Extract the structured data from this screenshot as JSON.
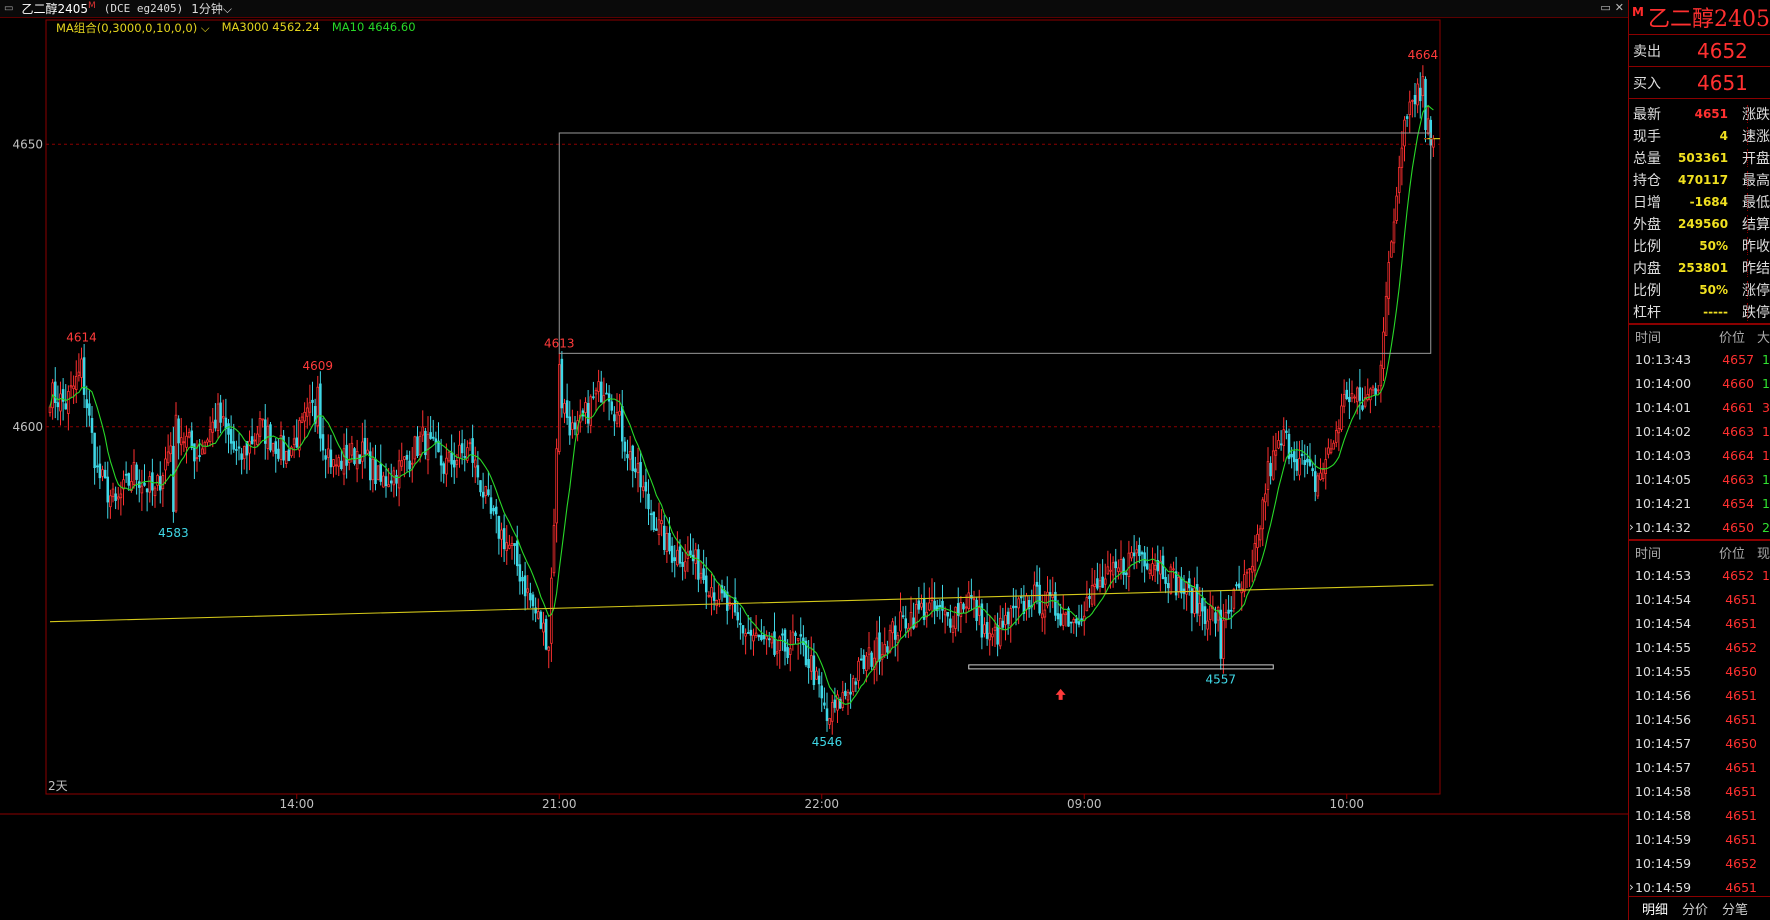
{
  "window": {
    "symbol": "乙二醇2405",
    "symbol_mark": "M",
    "code": "(DCE eg2405)",
    "period": "1分钟",
    "period_arrow": "⌵"
  },
  "legend": {
    "name": "MA组合(0,3000,0,10,0,0)",
    "ma3000": "MA3000 4562.24",
    "ma10": "MA10 4646.60"
  },
  "chart_data": {
    "type": "candlestick",
    "ylim": [
      4535,
      4672
    ],
    "y_ticks": [
      {
        "value": 4650,
        "label": "4650"
      },
      {
        "value": 4600,
        "label": "4600"
      }
    ],
    "x_ticks": [
      {
        "label": "14:00",
        "bar": 94
      },
      {
        "label": "21:00",
        "bar": 194
      },
      {
        "label": "22:00",
        "bar": 294
      },
      {
        "label": "09:00",
        "bar": 394
      },
      {
        "label": "10:00",
        "bar": 494
      }
    ],
    "day_marker": "2天",
    "current_price": 4651,
    "ma3000": {
      "start": 4565.5,
      "end": 4572.0
    },
    "anchors": [
      [
        0,
        4606
      ],
      [
        6,
        4604
      ],
      [
        12,
        4610
      ],
      [
        18,
        4592
      ],
      [
        25,
        4586
      ],
      [
        32,
        4592
      ],
      [
        40,
        4588
      ],
      [
        48,
        4600
      ],
      [
        56,
        4595
      ],
      [
        64,
        4602
      ],
      [
        72,
        4594
      ],
      [
        80,
        4600
      ],
      [
        90,
        4595
      ],
      [
        100,
        4603
      ],
      [
        108,
        4593
      ],
      [
        118,
        4596
      ],
      [
        126,
        4590
      ],
      [
        134,
        4593
      ],
      [
        142,
        4598
      ],
      [
        150,
        4593
      ],
      [
        160,
        4596
      ],
      [
        168,
        4584
      ],
      [
        176,
        4578
      ],
      [
        184,
        4568
      ],
      [
        190,
        4562
      ],
      [
        194,
        4606
      ],
      [
        200,
        4598
      ],
      [
        206,
        4604
      ],
      [
        212,
        4608
      ],
      [
        220,
        4596
      ],
      [
        228,
        4586
      ],
      [
        236,
        4578
      ],
      [
        244,
        4577
      ],
      [
        252,
        4572
      ],
      [
        262,
        4565
      ],
      [
        270,
        4562
      ],
      [
        276,
        4560
      ],
      [
        284,
        4562
      ],
      [
        290,
        4558
      ],
      [
        296,
        4548
      ],
      [
        302,
        4552
      ],
      [
        310,
        4558
      ],
      [
        318,
        4562
      ],
      [
        326,
        4566
      ],
      [
        334,
        4568
      ],
      [
        342,
        4566
      ],
      [
        350,
        4570
      ],
      [
        358,
        4562
      ],
      [
        366,
        4566
      ],
      [
        374,
        4570
      ],
      [
        382,
        4568
      ],
      [
        390,
        4566
      ],
      [
        398,
        4571
      ],
      [
        406,
        4574
      ],
      [
        414,
        4578
      ],
      [
        422,
        4576
      ],
      [
        430,
        4572
      ],
      [
        438,
        4568
      ],
      [
        446,
        4566
      ],
      [
        452,
        4570
      ],
      [
        458,
        4574
      ],
      [
        464,
        4592
      ],
      [
        470,
        4598
      ],
      [
        476,
        4594
      ],
      [
        482,
        4590
      ],
      [
        488,
        4596
      ],
      [
        494,
        4606
      ],
      [
        500,
        4604
      ],
      [
        506,
        4608
      ],
      [
        511,
        4632
      ],
      [
        516,
        4656
      ],
      [
        521,
        4660
      ],
      [
        526,
        4651
      ]
    ],
    "peaks": [
      {
        "label": "4614",
        "bar": 12,
        "value": 4614,
        "kind": "high"
      },
      {
        "label": "4583",
        "bar": 47,
        "value": 4583,
        "kind": "low"
      },
      {
        "label": "4609",
        "bar": 102,
        "value": 4609,
        "kind": "high"
      },
      {
        "label": "4613",
        "bar": 194,
        "value": 4613,
        "kind": "high"
      },
      {
        "label": "4546",
        "bar": 296,
        "value": 4546,
        "kind": "low"
      },
      {
        "label": "4557",
        "bar": 446,
        "value": 4557,
        "kind": "low"
      },
      {
        "label": "4664",
        "bar": 523,
        "value": 4664,
        "kind": "high"
      }
    ],
    "rect": {
      "from_bar": 194,
      "to_bar": 526,
      "top": 4652,
      "bottom": 4613
    },
    "support": {
      "from_bar": 350,
      "to_bar": 466,
      "value": 4557.5
    },
    "arrow_bar": 385
  },
  "quotes": {
    "sell_label": "卖出",
    "sell_value": "4652",
    "buy_label": "买入",
    "buy_value": "4651"
  },
  "stats": [
    {
      "label": "最新",
      "value": "4651",
      "color": "red",
      "right": "涨跌"
    },
    {
      "label": "现手",
      "value": "4",
      "color": "yel",
      "right": "速涨"
    },
    {
      "label": "总量",
      "value": "503361",
      "color": "yel",
      "right": "开盘"
    },
    {
      "label": "持仓",
      "value": "470117",
      "color": "yel",
      "right": "最高"
    },
    {
      "label": "日增",
      "value": "-1684",
      "color": "yel",
      "right": "最低"
    },
    {
      "label": "外盘",
      "value": "249560",
      "color": "yel",
      "right": "结算"
    },
    {
      "label": "比例",
      "value": "50%",
      "color": "yel",
      "right": "昨收"
    },
    {
      "label": "内盘",
      "value": "253801",
      "color": "yel",
      "right": "昨结"
    },
    {
      "label": "比例",
      "value": "50%",
      "color": "yel",
      "right": "涨停"
    },
    {
      "label": "杠杆",
      "value": "-----",
      "color": "yel",
      "right": "跌停"
    }
  ],
  "ticks1": {
    "head": [
      "时间",
      "价位",
      "大"
    ],
    "rows": [
      {
        "time": "10:13:43",
        "price": "4657",
        "vol": "1",
        "pc": "red",
        "vc": "grn"
      },
      {
        "time": "10:14:00",
        "price": "4660",
        "vol": "1",
        "pc": "red",
        "vc": "grn"
      },
      {
        "time": "10:14:01",
        "price": "4661",
        "vol": "3",
        "pc": "red",
        "vc": "red"
      },
      {
        "time": "10:14:02",
        "price": "4663",
        "vol": "1",
        "pc": "red",
        "vc": "red"
      },
      {
        "time": "10:14:03",
        "price": "4664",
        "vol": "1",
        "pc": "red",
        "vc": "red"
      },
      {
        "time": "10:14:05",
        "price": "4663",
        "vol": "1",
        "pc": "red",
        "vc": "grn"
      },
      {
        "time": "10:14:21",
        "price": "4654",
        "vol": "1",
        "pc": "red",
        "vc": "grn"
      },
      {
        "time": "10:14:32",
        "price": "4650",
        "vol": "2",
        "pc": "red",
        "vc": "grn"
      }
    ]
  },
  "ticks2": {
    "head": [
      "时间",
      "价位",
      "现"
    ],
    "rows": [
      {
        "time": "10:14:53",
        "price": "4652",
        "vol": "1",
        "pc": "red",
        "vc": "red"
      },
      {
        "time": "10:14:54",
        "price": "4651",
        "vol": "",
        "pc": "red",
        "vc": "red"
      },
      {
        "time": "10:14:54",
        "price": "4651",
        "vol": "",
        "pc": "red",
        "vc": "red"
      },
      {
        "time": "10:14:55",
        "price": "4652",
        "vol": "",
        "pc": "red",
        "vc": "red"
      },
      {
        "time": "10:14:55",
        "price": "4650",
        "vol": "",
        "pc": "red",
        "vc": "red"
      },
      {
        "time": "10:14:56",
        "price": "4651",
        "vol": "",
        "pc": "red",
        "vc": "red"
      },
      {
        "time": "10:14:56",
        "price": "4651",
        "vol": "",
        "pc": "red",
        "vc": "red"
      },
      {
        "time": "10:14:57",
        "price": "4650",
        "vol": "",
        "pc": "red",
        "vc": "red"
      },
      {
        "time": "10:14:57",
        "price": "4651",
        "vol": "",
        "pc": "red",
        "vc": "red"
      },
      {
        "time": "10:14:58",
        "price": "4651",
        "vol": "",
        "pc": "red",
        "vc": "red"
      },
      {
        "time": "10:14:58",
        "price": "4651",
        "vol": "",
        "pc": "red",
        "vc": "red"
      },
      {
        "time": "10:14:59",
        "price": "4651",
        "vol": "",
        "pc": "red",
        "vc": "red"
      },
      {
        "time": "10:14:59",
        "price": "4652",
        "vol": "",
        "pc": "red",
        "vc": "red"
      },
      {
        "time": "10:14:59",
        "price": "4651",
        "vol": "",
        "pc": "red",
        "vc": "red"
      }
    ]
  },
  "tabs": [
    "明细",
    "分价",
    "分笔"
  ],
  "colors": {
    "up": "#ff3030",
    "down": "#3fd7e6",
    "ma10": "#28d828",
    "ma3000": "#d4c81a",
    "grid": "#8b0000",
    "rect": "#9a9a9a"
  }
}
